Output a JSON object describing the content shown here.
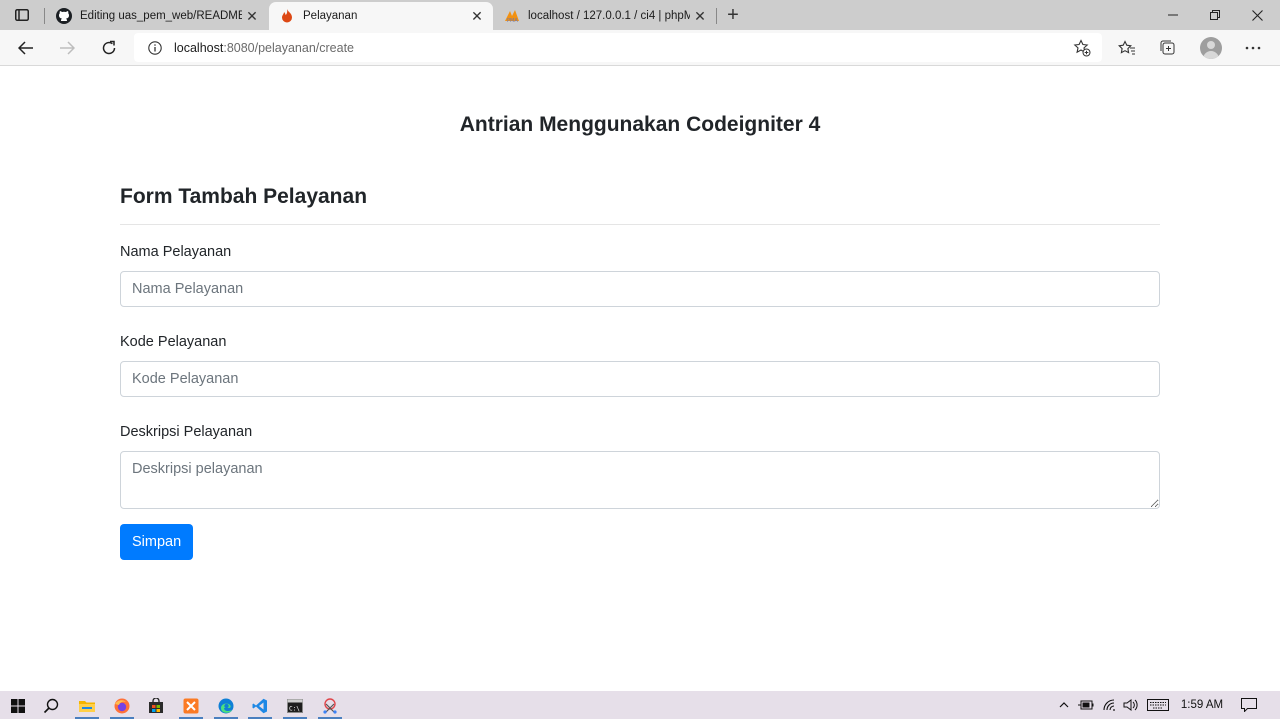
{
  "browser": {
    "tabs": [
      {
        "title": "Editing uas_pem_web/README.r",
        "icon": "github-icon",
        "active": false
      },
      {
        "title": "Pelayanan",
        "icon": "codeigniter-flame-icon",
        "active": true
      },
      {
        "title": "localhost / 127.0.0.1 / ci4 | phpM",
        "icon": "phpmyadmin-icon",
        "active": false
      }
    ],
    "address": {
      "host": "localhost",
      "path": ":8080/pelayanan/create"
    }
  },
  "page": {
    "app_title": "Antrian Menggunakan Codeigniter 4",
    "form_title": "Form Tambah Pelayanan",
    "fields": [
      {
        "label": "Nama Pelayanan",
        "placeholder": "Nama Pelayanan",
        "value": ""
      },
      {
        "label": "Kode Pelayanan",
        "placeholder": "Kode Pelayanan",
        "value": ""
      },
      {
        "label": "Deskripsi Pelayanan",
        "placeholder": "Deskripsi pelayanan",
        "value": ""
      }
    ],
    "submit_label": "Simpan",
    "primary_color": "#007bff"
  },
  "taskbar": {
    "apps": [
      "start-icon",
      "search-icon",
      "file-explorer-icon",
      "firefox-icon",
      "store-icon",
      "xampp-icon",
      "edge-icon",
      "vscode-icon",
      "terminal-icon",
      "snipping-tool-icon"
    ],
    "clock": "1:59 AM"
  }
}
